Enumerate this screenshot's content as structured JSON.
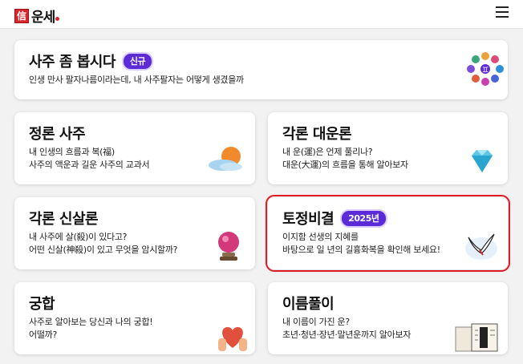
{
  "header": {
    "logo_mark": "信",
    "logo_text": "운세"
  },
  "cards": [
    {
      "title": "사주 좀 봅시다",
      "badge": "신규",
      "lines": [
        "인생 만사 팔자나름이라는데, 내 사주팔자는 어떻게 생겼을까"
      ],
      "icon": "zodiac-signs-icon"
    },
    {
      "title": "정론 사주",
      "lines": [
        "내 인생의 흐름과 복(福)",
        "사주의 액운과 길운 사주의 교과서"
      ],
      "icon": "sun-cloud-icon"
    },
    {
      "title": "각론 대운론",
      "lines": [
        "내 운(運)은 언제 풀리나?",
        "대운(大運)의 흐름을 통해 알아보자"
      ],
      "icon": "diamond-icon"
    },
    {
      "title": "각론 신살론",
      "lines": [
        "내 사주에 살(殺)이 있다고?",
        "어떤 신살(神殺)이 있고 무엇을 암시할까?"
      ],
      "icon": "crystal-ball-icon"
    },
    {
      "title": "토정비결",
      "badge": "2025년",
      "lines": [
        "이지함 선생의 지혜를",
        "바탕으로 일 년의 길흉화복을 확인해 보세요!"
      ],
      "icon": "crane-icon"
    },
    {
      "title": "궁합",
      "lines": [
        "사주로 알아보는 당신과 나의 궁합!",
        "어떨까?"
      ],
      "icon": "heart-hands-icon"
    },
    {
      "title": "이름풀이",
      "lines": [
        "내 이름이 가진 운?",
        "초년·청년·장년·말년운까지 알아보자"
      ],
      "icon": "name-book-icon"
    }
  ],
  "colors": {
    "accent": "#5b2bd8",
    "brand": "#d7262e",
    "highlight": "#e01b24"
  }
}
